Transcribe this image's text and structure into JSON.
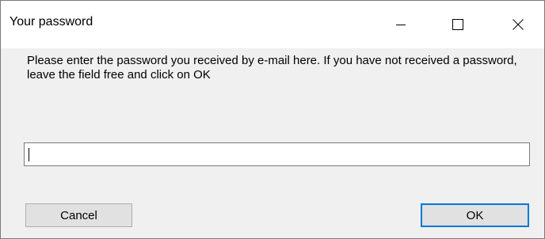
{
  "window": {
    "title": "Your password"
  },
  "titlebar": {
    "icons": [
      "minimize-icon",
      "maximize-icon",
      "close-icon"
    ]
  },
  "dialog": {
    "message": "Please enter the password you received by e-mail here. If you have not received a password, leave the field free and click on OK",
    "password_value": ""
  },
  "buttons": {
    "cancel_label": "Cancel",
    "ok_label": "OK"
  },
  "colors": {
    "accent": "#0078d7",
    "dialog_background": "#f0f0f0",
    "button_background": "#e1e1e1"
  }
}
